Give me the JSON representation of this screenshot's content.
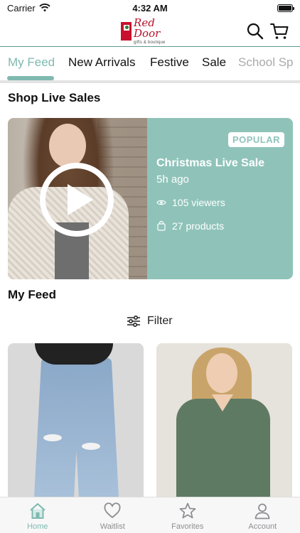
{
  "status_bar": {
    "carrier": "Carrier",
    "time": "4:32 AM"
  },
  "header": {
    "logo_name": "Red Door",
    "logo_sub": "gifts & boutique"
  },
  "tabs": [
    {
      "label": "My Feed",
      "active": true
    },
    {
      "label": "New Arrivals"
    },
    {
      "label": "Festive"
    },
    {
      "label": "Sale"
    },
    {
      "label": "School Sp"
    }
  ],
  "live_section": {
    "title": "Shop Live Sales",
    "card": {
      "badge": "POPULAR",
      "title": "Christmas Live Sale",
      "time": "5h ago",
      "viewers": "105 viewers",
      "products": "27 products"
    }
  },
  "feed_section": {
    "title": "My Feed",
    "filter_label": "Filter"
  },
  "nav": [
    {
      "label": "Home",
      "icon": "home-icon",
      "active": true
    },
    {
      "label": "Waitlist",
      "icon": "heart-icon"
    },
    {
      "label": "Favorites",
      "icon": "star-icon"
    },
    {
      "label": "Account",
      "icon": "person-icon"
    }
  ],
  "colors": {
    "accent": "#7fb9b0",
    "card_bg": "#8fc3ba",
    "brand_red": "#b8102a"
  }
}
